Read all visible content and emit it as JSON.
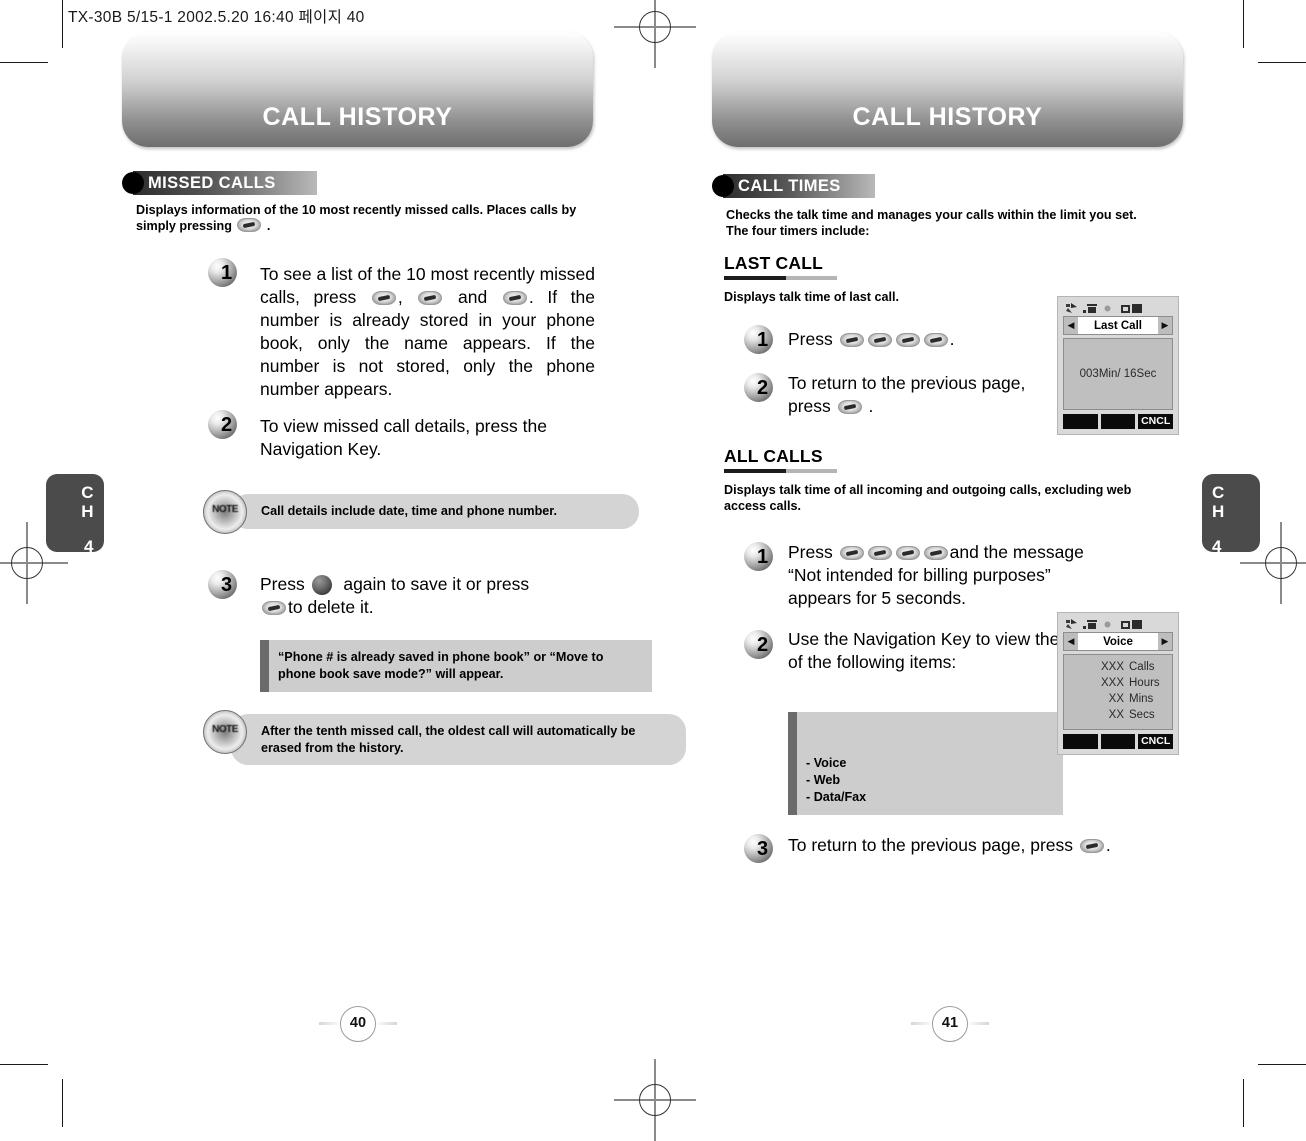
{
  "document": {
    "slug": "TX-30B 5/15-1  2002.5.20 16:40  페이지 40"
  },
  "chapter_tabs": {
    "left": {
      "ch": "C\nH",
      "num": "4"
    },
    "right": {
      "ch": "C\nH",
      "num": "4"
    }
  },
  "pages": [
    {
      "banner_title": "CALL HISTORY",
      "page_number": "40",
      "section": {
        "label": "MISSED CALLS",
        "intro": "Displays information of the 10 most recently missed calls. Places calls by simply pressing"
      },
      "steps": [
        {
          "num": "1",
          "text_a": "To see a list of the 10 most recently missed calls, press",
          "text_b": ",",
          "text_c": "and",
          "text_d": ". If the number is already stored in your phone book, only the name appears. If the number is not stored, only the phone number appears."
        },
        {
          "num": "2",
          "text_a": "To view missed call details, press the Navigation Key."
        },
        {
          "num": "3",
          "text_a": "Press",
          "text_b": "again to save it or press",
          "text_c": "to delete it."
        }
      ],
      "notes": [
        {
          "badge": "NOTE",
          "text": "Call details include date, time and phone number."
        },
        {
          "badge": "NOTE",
          "text": "After the tenth missed call, the oldest call will automatically be erased from the history."
        }
      ],
      "callouts": [
        {
          "text": "“Phone # is already saved in phone book” or “Move to phone book save mode?” will appear."
        }
      ]
    },
    {
      "banner_title": "CALL HISTORY",
      "page_number": "41",
      "section": {
        "label": "CALL TIMES",
        "intro": "Checks the talk time and manages your calls within the limit you set.\nThe four timers include:"
      },
      "subsections": [
        {
          "heading": "LAST CALL",
          "intro": "Displays talk time of last call.",
          "steps": [
            {
              "num": "1",
              "text_a": "Press",
              "text_b": "."
            },
            {
              "num": "2",
              "text_a": "To return to the previous page, press",
              "text_b": "."
            }
          ],
          "phone": {
            "title": "Last Call",
            "lcd_center": "003Min/ 16Sec",
            "softkey_right": "CNCL"
          }
        },
        {
          "heading": "ALL CALLS",
          "intro": "Displays talk time of all incoming and outgoing calls, excluding web access calls.",
          "steps": [
            {
              "num": "1",
              "text_a": "Press",
              "text_b": "and the message “Not intended for billing purposes” appears for 5 seconds."
            },
            {
              "num": "2",
              "text_a": "Use the Navigation Key to view the time of the following items:"
            },
            {
              "num": "3",
              "text_a": "To return to the previous page, press",
              "text_b": "."
            }
          ],
          "callout_items": "- Voice\n- Web\n- Data/Fax",
          "phone": {
            "title": "Voice",
            "rows": [
              {
                "value": "XXX",
                "unit": "Calls"
              },
              {
                "value": "XXX",
                "unit": "Hours"
              },
              {
                "value": "XX",
                "unit": "Mins"
              },
              {
                "value": "XX",
                "unit": "Secs"
              }
            ],
            "softkey_right": "CNCL"
          }
        }
      ]
    }
  ],
  "colors": {
    "tab_bg": "#4b4b4b",
    "callout_bg": "#cdcdcd",
    "note_bg": "#d4d4d4",
    "lcd_bg": "#bfbfbf"
  }
}
